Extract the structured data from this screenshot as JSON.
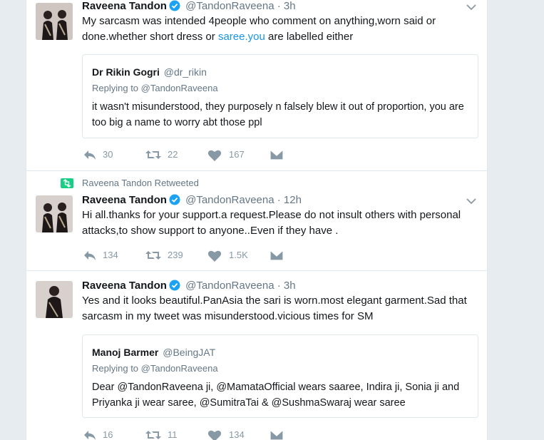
{
  "tweets": [
    {
      "fullname": "Raveena Tandon",
      "handle": "@TandonRaveena",
      "dot": "·",
      "time": "3h",
      "text_before_link": "My sarcasm was intended 4people who comment on anything,worn said or done.whether short dress or ",
      "link": "saree.you",
      "text_after_link": " are labelled either",
      "quote": {
        "name": "Dr Rikin Gogri",
        "handle": "@dr_rikin",
        "replying_label": "Replying to",
        "replying_to": "@TandonRaveena",
        "text": "it wasn't misunderstood, they purposely n falsely blew it out of proportion, you are too big a name to worry abt those ppl"
      },
      "replies": "30",
      "retweets": "22",
      "likes": "167"
    },
    {
      "social_context": "Raveena Tandon Retweeted",
      "fullname": "Raveena Tandon",
      "handle": "@TandonRaveena",
      "dot": "·",
      "time": "12h",
      "text": "Hi all.thanks for your support.a request.Please do not insult others with personal attacks,to show support to anyone..Even if they have .",
      "replies": "134",
      "retweets": "239",
      "likes": "1.5K"
    },
    {
      "fullname": "Raveena Tandon",
      "handle": "@TandonRaveena",
      "dot": "·",
      "time": "3h",
      "text": "Yes and it looks beautiful.PanAsia the sari is worn.most elegant garment.Sad that sarcasm in my tweet was misunderstood.vicious times for SM",
      "quote": {
        "name": "Manoj Barmer",
        "handle": "@BeingJAT",
        "replying_label": "Replying to",
        "replying_to": "@TandonRaveena",
        "text": "Dear @TandonRaveena ji, @MamataOfficial wears saaree, Indira ji, Sonia ji and Priyanka ji wear saree, @SumitraTai & @SushmaSwaraj wear saree"
      },
      "replies": "16",
      "retweets": "11",
      "likes": "134"
    }
  ],
  "icons": {
    "reply": "reply-icon",
    "retweet": "retweet-icon",
    "like": "heart-icon",
    "message": "direct-message-icon",
    "verified": "verified-badge-icon",
    "caret": "chevron-down-icon"
  },
  "colors": {
    "link": "#1b95e0",
    "verified": "#1da1f2",
    "retweet_context": "#19cf86",
    "action_icons": "#8899a6",
    "secondary_text": "#657786"
  }
}
